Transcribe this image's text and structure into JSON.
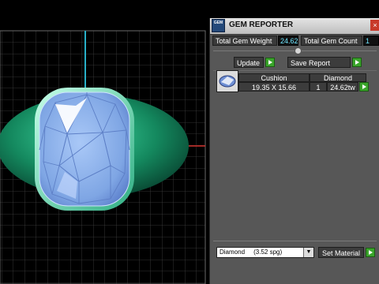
{
  "panel": {
    "title": "GEM REPORTER",
    "logo_text": "GEM",
    "close_glyph": "×",
    "total_gem_weight_label": "Total Gem Weight",
    "total_gem_weight_value": "24.62",
    "total_gem_count_label": "Total Gem Count",
    "total_gem_count_value": "1",
    "update_label": "Update",
    "save_report_label": "Save Report",
    "table": {
      "columns": [
        "Cushion",
        "Diamond"
      ],
      "row": {
        "dimensions": "19.35 X 15.66",
        "count": "1",
        "weight": "24.62tw"
      }
    },
    "material_select_value": "Diamond     (3.52 spg)",
    "set_material_label": "Set Material"
  },
  "colors": {
    "panel_bg": "#575757",
    "value_text": "#6ee6ff",
    "play_button": "#3aa52b",
    "band": "#1fa77a",
    "gem": "#8fb3ee",
    "grid": "#3f3f3f"
  },
  "icons": [
    "gem-reporter-logo-icon",
    "close-icon",
    "play-icon",
    "gem-thumbnail-icon",
    "dropdown-arrow-icon"
  ]
}
